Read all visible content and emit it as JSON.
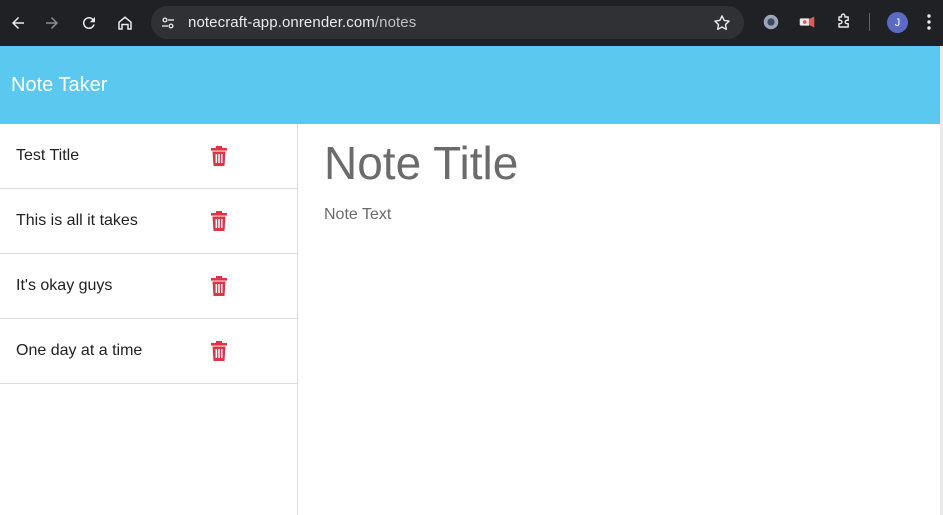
{
  "browser": {
    "url_host": "notecraft-app.onrender.com",
    "url_path": "/notes",
    "profile_initial": "J"
  },
  "app": {
    "title": "Note Taker"
  },
  "notes": [
    {
      "label": "Test Title"
    },
    {
      "label": "This is all it takes"
    },
    {
      "label": "It's okay guys"
    },
    {
      "label": "One day at a time"
    }
  ],
  "editor": {
    "title_placeholder": "Note Title",
    "text_placeholder": "Note Text"
  },
  "colors": {
    "header": "#5bc8ef",
    "delete_icon": "#dc3545",
    "chrome": "#202124"
  }
}
